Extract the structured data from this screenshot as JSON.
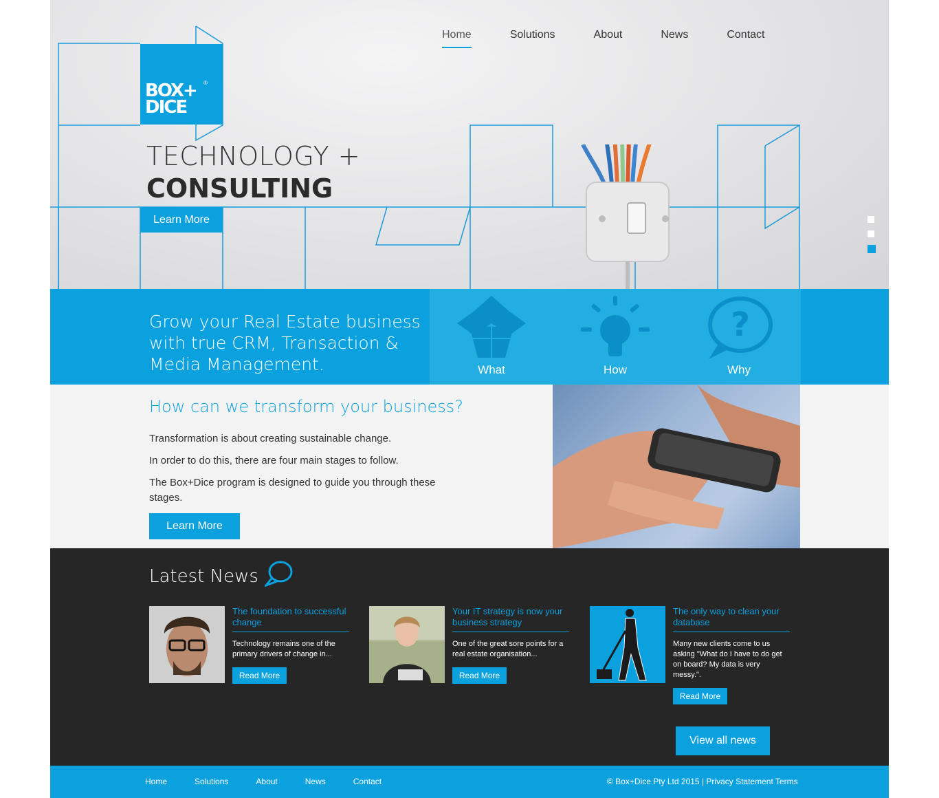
{
  "brand": {
    "logo_text_1": "BOX+",
    "logo_text_2": "DICE",
    "logo_reg": "®"
  },
  "nav": {
    "items": [
      {
        "label": "Home",
        "active": true
      },
      {
        "label": "Solutions"
      },
      {
        "label": "About"
      },
      {
        "label": "News"
      },
      {
        "label": "Contact"
      }
    ]
  },
  "hero": {
    "title_line1": "TECHNOLOGY +",
    "title_line2": "CONSULTING",
    "button_label": "Learn More",
    "slide_dots": 3,
    "active_slide": 3
  },
  "band": {
    "tagline": "Grow your Real Estate business with true CRM, Transaction & Media Management.",
    "items": [
      {
        "label": "What",
        "icon": "box-icon"
      },
      {
        "label": "How",
        "icon": "lightbulb-icon"
      },
      {
        "label": "Why",
        "icon": "question-bubble-icon"
      }
    ]
  },
  "transform": {
    "heading": "How can we transform your business?",
    "paragraphs": [
      "Transformation is about creating sustainable change.",
      "In order to do this, there are four main stages to follow.",
      "The Box+Dice program is designed to guide you through these stages."
    ],
    "button_label": "Learn More"
  },
  "news": {
    "heading": "Latest News",
    "cards": [
      {
        "title": "The foundation to successful change",
        "desc": "Technology remains one of the primary drivers of change in...",
        "button": "Read More"
      },
      {
        "title": "Your IT strategy is now your business strategy",
        "desc": "One of the great sore points for a real estate organisation...",
        "button": "Read More"
      },
      {
        "title": "The only way to clean your database",
        "desc": "Many new clients come to us asking \"What do I have to do get on board? My data is very messy.\".",
        "button": "Read More"
      }
    ],
    "view_all": "View all news"
  },
  "footer": {
    "nav": [
      "Home",
      "Solutions",
      "About",
      "News",
      "Contact"
    ],
    "copyright": "© Box+Dice Pty Ltd 2015",
    "separator": "|",
    "privacy": "Privacy Statement",
    "terms": "Terms"
  },
  "colors": {
    "accent": "#0aa1de",
    "dark": "#262626",
    "light_bg": "#f3f3f3"
  }
}
